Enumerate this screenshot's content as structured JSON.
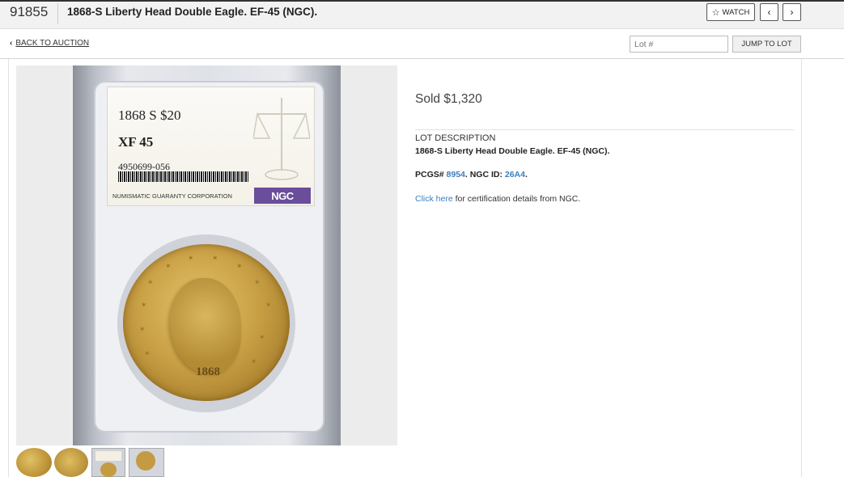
{
  "header": {
    "lot_number": "91855",
    "title": "1868-S Liberty Head Double Eagle. EF-45 (NGC).",
    "watch_label": "WATCH",
    "prev_icon": "chevron-left-icon",
    "next_icon": "chevron-right-icon"
  },
  "subbar": {
    "back_label": "BACK TO AUCTION",
    "lot_placeholder": "Lot #",
    "jump_label": "JUMP TO LOT"
  },
  "image": {
    "label_line1": "1868 S $20",
    "label_grade": "XF 45",
    "label_cert": "4950699-056",
    "label_corp": "NUMISMATIC GUARANTY CORPORATION",
    "label_logo": "NGC",
    "coin_date": "1868"
  },
  "thumbnails": [
    "coin-obverse",
    "coin-reverse",
    "slab-front",
    "slab-back"
  ],
  "details": {
    "sold": "Sold $1,320",
    "desc_label": "LOT DESCRIPTION",
    "desc_text": "1868-S Liberty Head Double Eagle. EF-45 (NGC).",
    "pcgs_prefix": "PCGS# ",
    "pcgs_num": "8954",
    "ngc_prefix": ". NGC ID: ",
    "ngc_id": "26A4",
    "ngc_suffix": ".",
    "cert_link": "Click here",
    "cert_rest": " for certification details from NGC."
  },
  "colors": {
    "link": "#3b7fbf",
    "ngc_logo": "#6a4e9c"
  }
}
